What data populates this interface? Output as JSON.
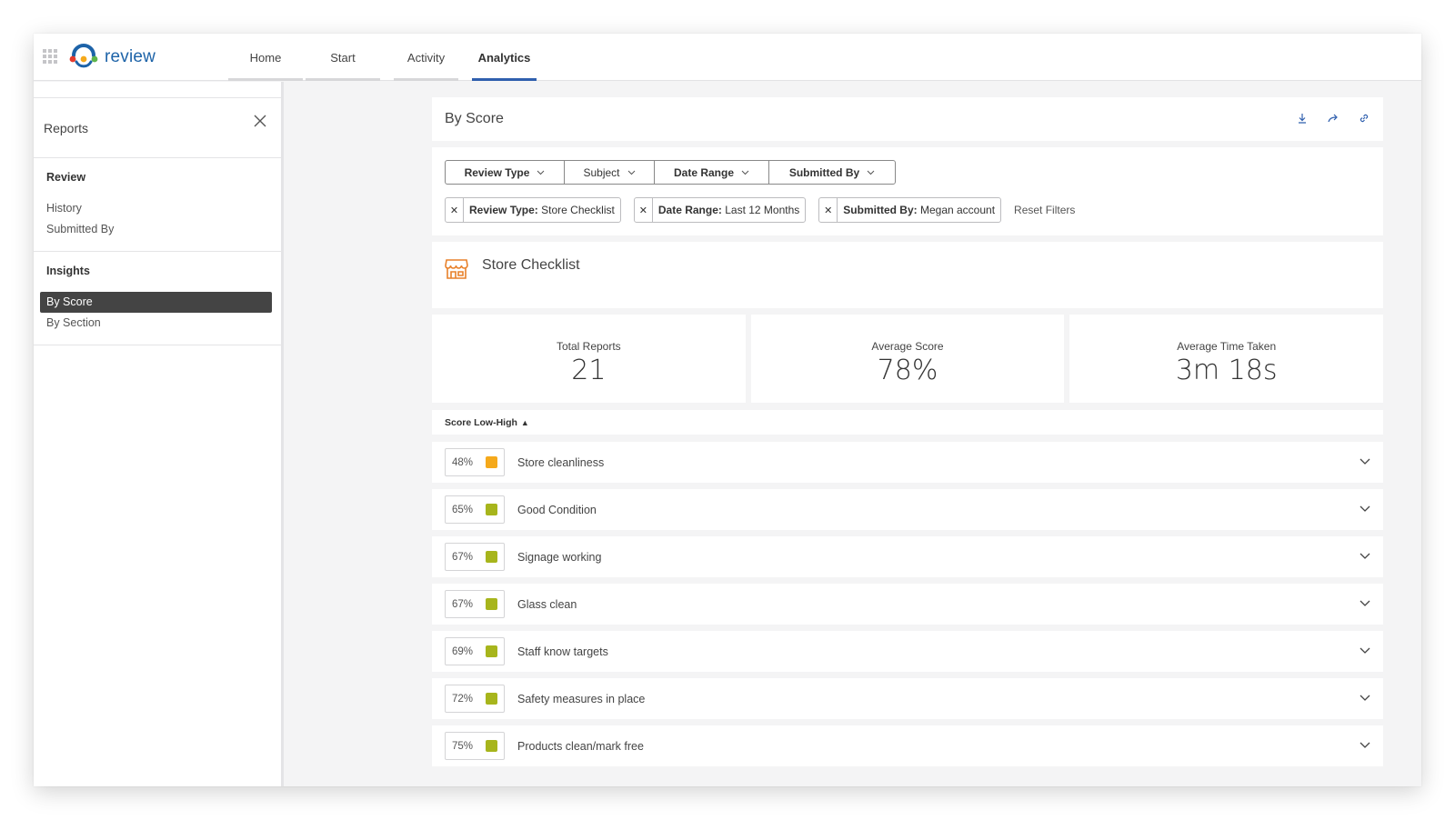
{
  "app": {
    "name": "review"
  },
  "nav": {
    "items": [
      {
        "label": "Home",
        "active": false
      },
      {
        "label": "Start",
        "active": false
      },
      {
        "label": "Activity",
        "active": false
      },
      {
        "label": "Analytics",
        "active": true
      }
    ]
  },
  "sidebar": {
    "title": "Reports",
    "sections": [
      {
        "heading": "Review",
        "items": [
          {
            "label": "History"
          },
          {
            "label": "Submitted By"
          }
        ]
      },
      {
        "heading": "Insights",
        "items": [
          {
            "label": "By Score",
            "active": true
          },
          {
            "label": "By Section"
          }
        ]
      }
    ]
  },
  "header": {
    "title": "By Score"
  },
  "filters": {
    "buttons": [
      "Review Type",
      "Subject",
      "Date Range",
      "Submitted By"
    ],
    "chips": [
      {
        "key": "Review Type:",
        "value": "Store Checklist"
      },
      {
        "key": "Date Range:",
        "value": "Last 12 Months"
      },
      {
        "key": "Submitted By:",
        "value": "Megan account"
      }
    ],
    "reset_label": "Reset Filters"
  },
  "subject": {
    "title": "Store Checklist"
  },
  "stats": [
    {
      "label": "Total Reports",
      "value": "21"
    },
    {
      "label": "Average Score",
      "value": "78%"
    },
    {
      "label": "Average Time Taken",
      "value": "3m 18s"
    }
  ],
  "sort": {
    "label": "Score Low-High",
    "arrow": "▲"
  },
  "colors": {
    "accent": "#2f5fae",
    "orange": "#f5a91b",
    "olive": "#a7b51c",
    "store_icon": "#e8812a"
  },
  "rows": [
    {
      "score": "48%",
      "label": "Store cleanliness",
      "color": "#f5a91b"
    },
    {
      "score": "65%",
      "label": "Good Condition",
      "color": "#a7b51c"
    },
    {
      "score": "67%",
      "label": "Signage working",
      "color": "#a7b51c"
    },
    {
      "score": "67%",
      "label": "Glass clean",
      "color": "#a7b51c"
    },
    {
      "score": "69%",
      "label": "Staff know targets",
      "color": "#a7b51c"
    },
    {
      "score": "72%",
      "label": "Safety measures in place",
      "color": "#a7b51c"
    },
    {
      "score": "75%",
      "label": "Products clean/mark free",
      "color": "#a7b51c"
    }
  ]
}
